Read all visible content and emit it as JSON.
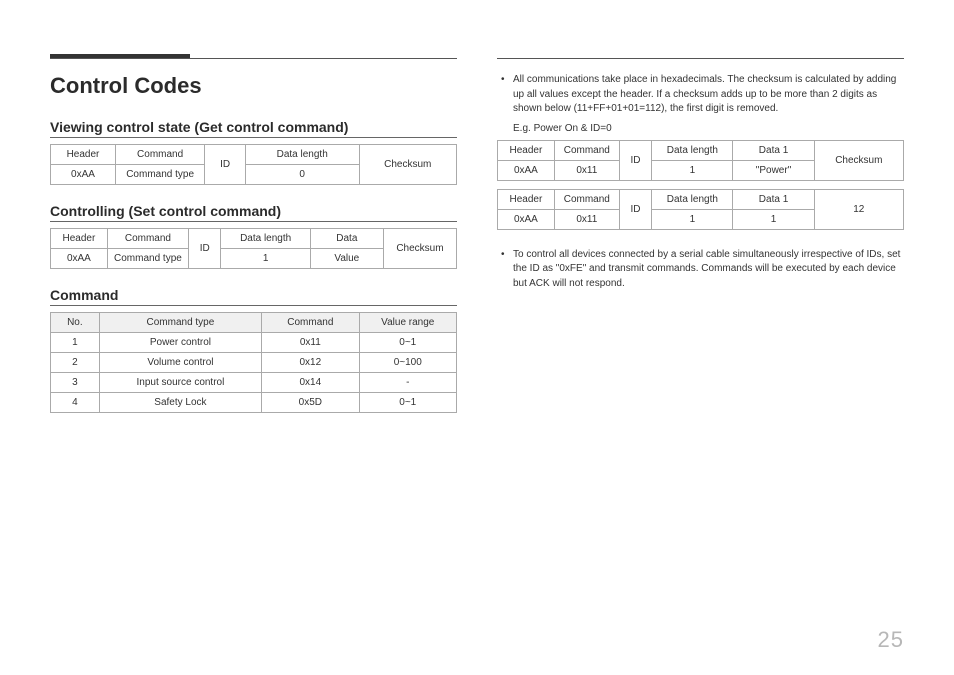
{
  "page": {
    "title": "Control Codes",
    "number": "25"
  },
  "left": {
    "sections": {
      "view": "Viewing control state (Get control command)",
      "control": "Controlling (Set control command)",
      "command": "Command"
    },
    "view_table": {
      "h": {
        "header": "Header",
        "command": "Command",
        "id": "ID",
        "dlen": "Data length",
        "checksum": "Checksum"
      },
      "r": {
        "header": "0xAA",
        "command": "Command type",
        "dlen": "0"
      }
    },
    "control_table": {
      "h": {
        "header": "Header",
        "command": "Command",
        "id": "ID",
        "dlen": "Data length",
        "data": "Data",
        "checksum": "Checksum"
      },
      "r": {
        "header": "0xAA",
        "command": "Command type",
        "dlen": "1",
        "data": "Value"
      }
    },
    "cmd_table": {
      "h": {
        "no": "No.",
        "type": "Command type",
        "cmd": "Command",
        "range": "Value range"
      },
      "rows": [
        {
          "no": "1",
          "type": "Power control",
          "cmd": "0x11",
          "range": "0~1"
        },
        {
          "no": "2",
          "type": "Volume control",
          "cmd": "0x12",
          "range": "0~100"
        },
        {
          "no": "3",
          "type": "Input source control",
          "cmd": "0x14",
          "range": "-"
        },
        {
          "no": "4",
          "type": "Safety Lock",
          "cmd": "0x5D",
          "range": "0~1"
        }
      ]
    }
  },
  "right": {
    "note1": "All communications take place in hexadecimals. The checksum is calculated by adding up all values except the header. If a checksum adds up to be more than 2 digits as shown below (11+FF+01+01=112), the first digit is removed.",
    "eg": "E.g. Power On & ID=0",
    "ex_table1": {
      "h": {
        "header": "Header",
        "command": "Command",
        "id": "ID",
        "dlen": "Data length",
        "data1": "Data 1",
        "checksum": "Checksum"
      },
      "r": {
        "header": "0xAA",
        "command": "0x11",
        "dlen": "1",
        "data1": "\"Power\""
      }
    },
    "ex_table2": {
      "h": {
        "header": "Header",
        "command": "Command",
        "id": "ID",
        "dlen": "Data length",
        "data1": "Data 1",
        "checksum": "12"
      },
      "r": {
        "header": "0xAA",
        "command": "0x11",
        "dlen": "1",
        "data1": "1"
      }
    },
    "note2": "To control all devices connected by a serial cable simultaneously irrespective of IDs, set the ID as \"0xFE\" and transmit commands. Commands will be executed by each device but ACK will not respond."
  }
}
